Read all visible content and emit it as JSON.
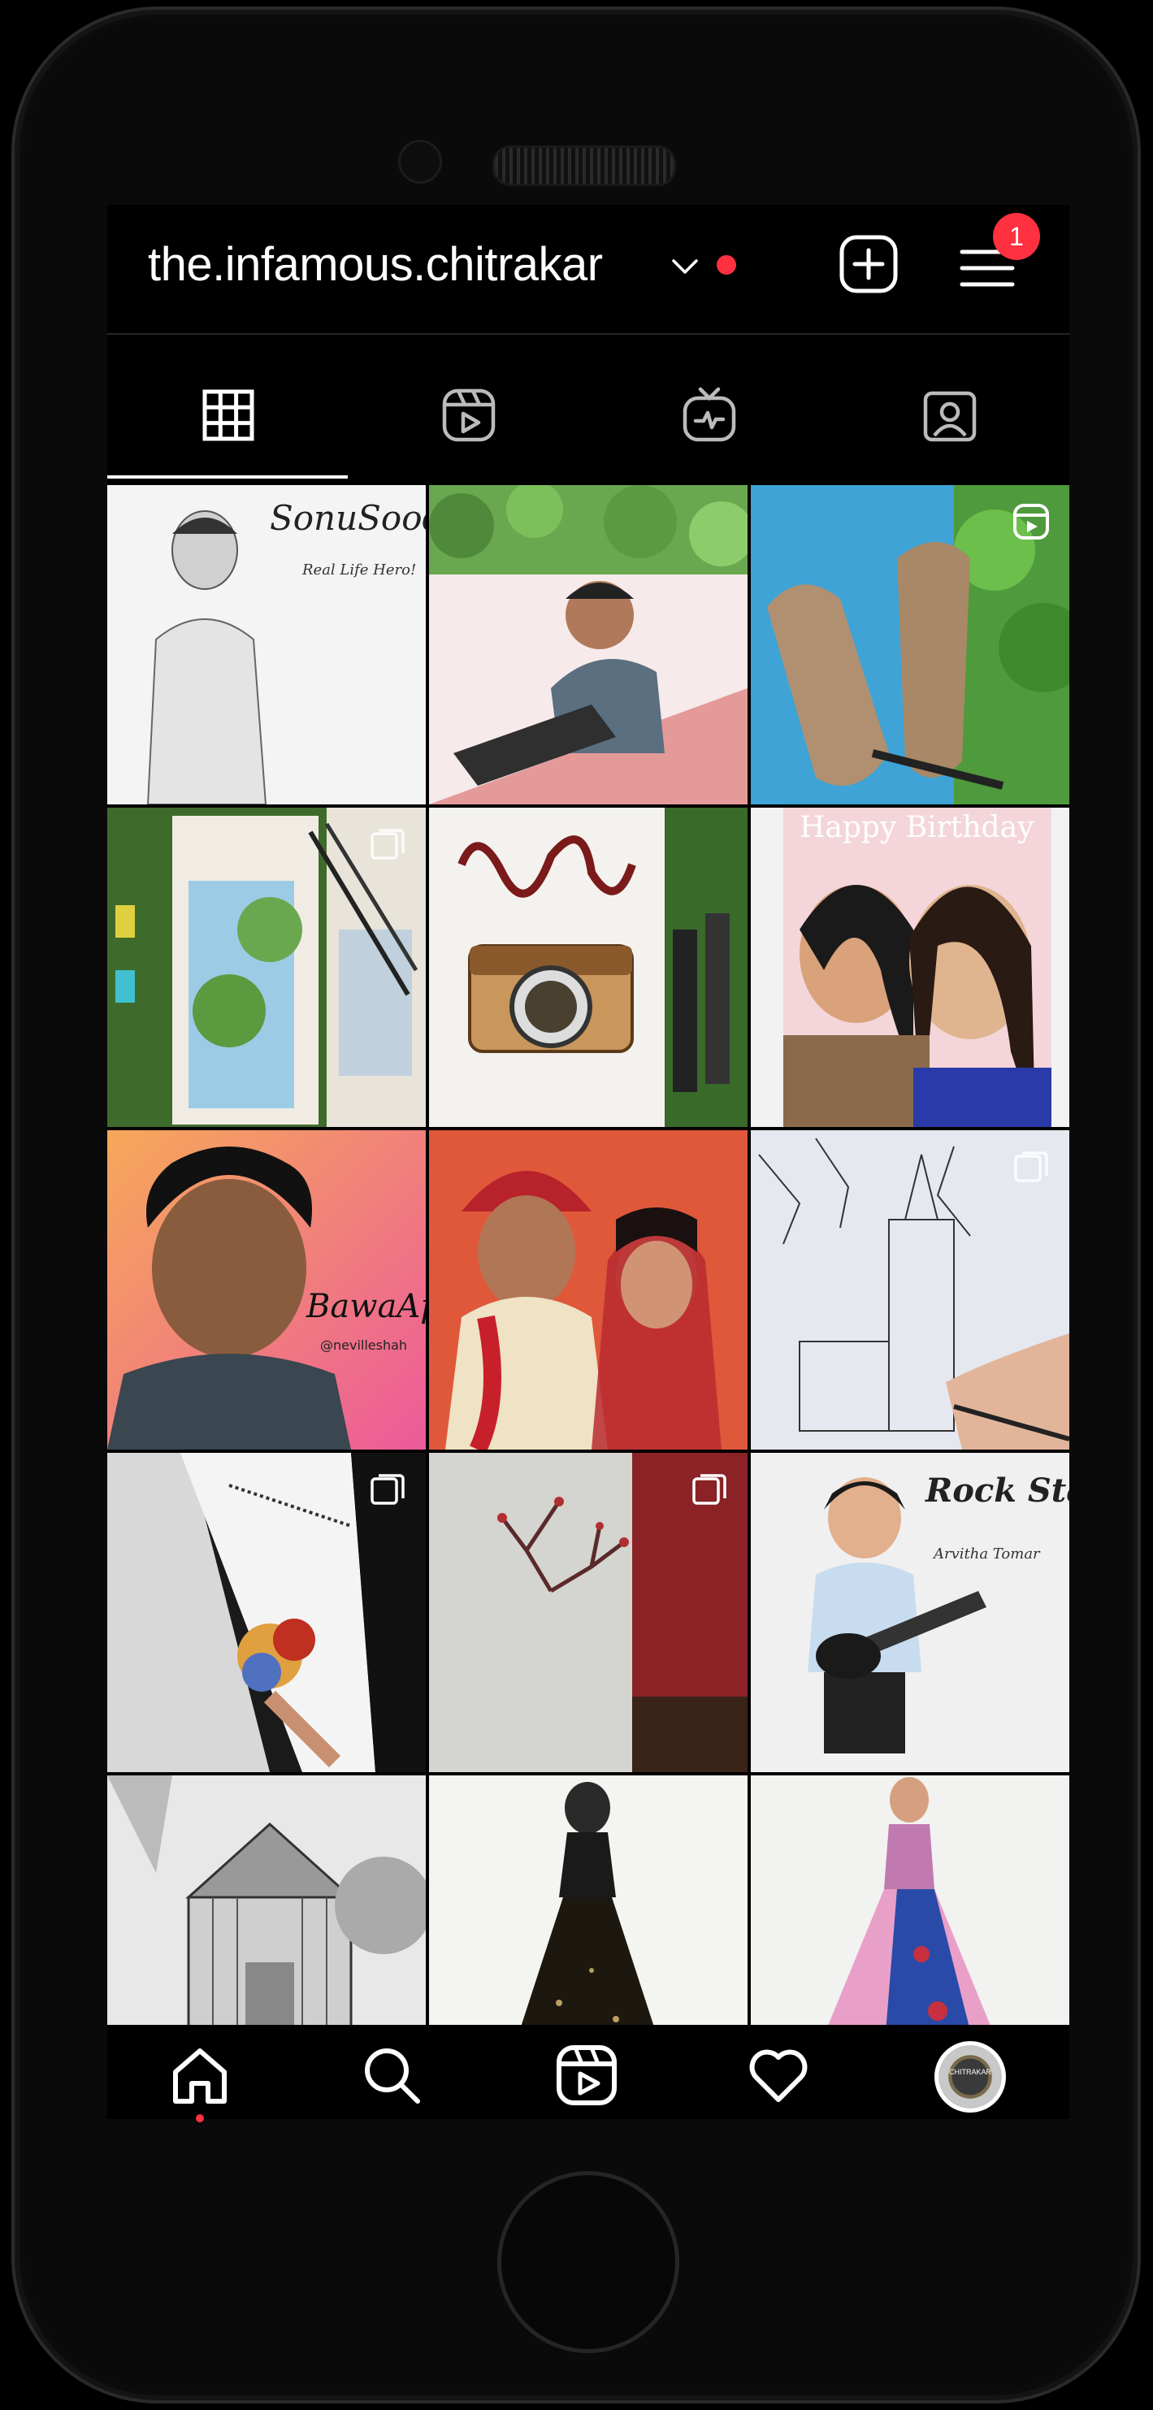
{
  "profile": {
    "username": "the.infamous.chitrakar",
    "notification_count": "1",
    "avatar_text": "CHITRAKAR"
  },
  "tabs": [
    {
      "name": "posts",
      "icon": "grid-icon",
      "selected": true
    },
    {
      "name": "reels",
      "icon": "reels-icon",
      "selected": false
    },
    {
      "name": "igtv",
      "icon": "igtv-icon",
      "selected": false
    },
    {
      "name": "tagged",
      "icon": "tagged-user-icon",
      "selected": false
    }
  ],
  "posts": [
    {
      "id": 1,
      "subject": "sketch portrait",
      "text": "SonuSood",
      "subtext": "Real Life Hero!",
      "type": "image"
    },
    {
      "id": 2,
      "subject": "illustrated man with leaves",
      "text": "",
      "type": "image"
    },
    {
      "id": 3,
      "subject": "painted feet",
      "text": "",
      "type": "reel"
    },
    {
      "id": 4,
      "subject": "watercolor with brushes",
      "text": "",
      "type": "carousel"
    },
    {
      "id": 5,
      "subject": "camera illustration",
      "text": "",
      "type": "image"
    },
    {
      "id": 6,
      "subject": "birthday portrait",
      "text": "Happy Birthday",
      "type": "image"
    },
    {
      "id": 7,
      "subject": "curly hair portrait",
      "text": "BawaAp!",
      "subtext": "@nevilleshah",
      "type": "image"
    },
    {
      "id": 8,
      "subject": "wedding couple",
      "text": "",
      "type": "image"
    },
    {
      "id": 9,
      "subject": "church sketch",
      "text": "",
      "type": "carousel"
    },
    {
      "id": 10,
      "subject": "notebook art",
      "text": "",
      "type": "carousel"
    },
    {
      "id": 11,
      "subject": "wall painting",
      "text": "",
      "type": "carousel"
    },
    {
      "id": 12,
      "subject": "guitar caricature",
      "text": "Rock Star",
      "subtext": "Arvitha Tomar",
      "type": "image"
    },
    {
      "id": 13,
      "subject": "barn sketch",
      "text": "",
      "type": "image"
    },
    {
      "id": 14,
      "subject": "black gown",
      "text": "",
      "type": "image"
    },
    {
      "id": 15,
      "subject": "blue pink gown",
      "text": "",
      "type": "image"
    }
  ],
  "bottom_nav": [
    {
      "name": "home",
      "icon": "home-icon",
      "active": true
    },
    {
      "name": "search",
      "icon": "search-icon",
      "active": false
    },
    {
      "name": "reels",
      "icon": "reels-icon",
      "active": false
    },
    {
      "name": "activity",
      "icon": "heart-icon",
      "active": false
    },
    {
      "name": "profile",
      "icon": "avatar",
      "active": false
    }
  ],
  "colors": {
    "background": "#000000",
    "text": "#ffffff",
    "accent_red": "#ff3040",
    "divider": "#262626"
  }
}
